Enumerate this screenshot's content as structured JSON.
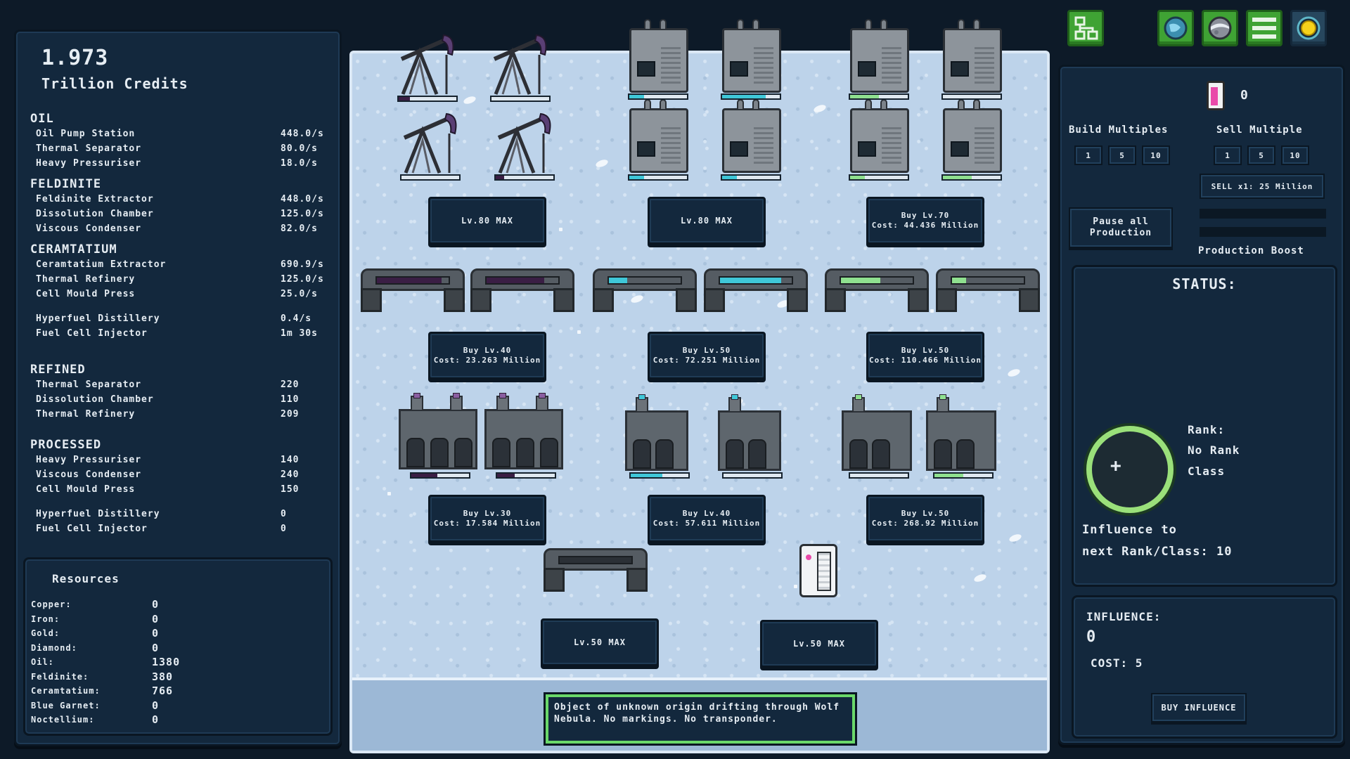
{
  "credits": {
    "amount": "1.973",
    "label": "Trillion Credits"
  },
  "stats": {
    "oil": {
      "title": "OIL",
      "rows": [
        {
          "name": "Oil Pump Station",
          "value": "448.0/s"
        },
        {
          "name": "Thermal Separator",
          "value": "80.0/s"
        },
        {
          "name": "Heavy Pressuriser",
          "value": "18.0/s"
        }
      ]
    },
    "feldinite": {
      "title": "FELDINITE",
      "rows": [
        {
          "name": "Feldinite Extractor",
          "value": "448.0/s"
        },
        {
          "name": "Dissolution Chamber",
          "value": "125.0/s"
        },
        {
          "name": "Viscous Condenser",
          "value": "82.0/s"
        }
      ]
    },
    "ceramtatium": {
      "title": "CERAMTATIUM",
      "rows": [
        {
          "name": "Ceramtatium Extractor",
          "value": "690.9/s"
        },
        {
          "name": "Thermal Refinery",
          "value": "125.0/s"
        },
        {
          "name": "Cell Mould Press",
          "value": "25.0/s"
        }
      ]
    },
    "fuel": {
      "rows": [
        {
          "name": "Hyperfuel Distillery",
          "value": "0.4/s"
        },
        {
          "name": "Fuel Cell Injector",
          "value": "1m 30s"
        }
      ]
    },
    "refined": {
      "title": "REFINED",
      "rows": [
        {
          "name": "Thermal Separator",
          "value": "220"
        },
        {
          "name": "Dissolution Chamber",
          "value": "110"
        },
        {
          "name": "Thermal Refinery",
          "value": "209"
        }
      ]
    },
    "processed": {
      "title": "PROCESSED",
      "rows": [
        {
          "name": "Heavy Pressuriser",
          "value": "140"
        },
        {
          "name": "Viscous Condenser",
          "value": "240"
        },
        {
          "name": "Cell Mould Press",
          "value": "150"
        }
      ]
    },
    "processed_fuel": {
      "rows": [
        {
          "name": "Hyperfuel Distillery",
          "value": "0"
        },
        {
          "name": "Fuel Cell Injector",
          "value": "0"
        }
      ]
    }
  },
  "resources": {
    "title": "Resources",
    "items": [
      {
        "name": "Copper:",
        "value": "0"
      },
      {
        "name": "Iron:",
        "value": "0"
      },
      {
        "name": "Gold:",
        "value": "0"
      },
      {
        "name": "Diamond:",
        "value": "0"
      },
      {
        "name": "Oil:",
        "value": "1380"
      },
      {
        "name": "Feldinite:",
        "value": "380"
      },
      {
        "name": "Ceramtatium:",
        "value": "766"
      },
      {
        "name": "Blue Garnet:",
        "value": "0"
      },
      {
        "name": "Noctellium:",
        "value": "0"
      }
    ]
  },
  "top_icons": [
    {
      "name": "network-icon"
    },
    {
      "name": "planet-blue-icon"
    },
    {
      "name": "planet-rock-icon"
    },
    {
      "name": "menu-icon"
    },
    {
      "name": "sun-icon"
    }
  ],
  "machines": {
    "row1": [
      {
        "label": "Lv.80 MAX",
        "line2": ""
      },
      {
        "label": "Lv.80 MAX",
        "line2": ""
      },
      {
        "label": "Buy Lv.70",
        "line2": "Cost: 44.436 Million"
      }
    ],
    "row2": [
      {
        "label": "Buy Lv.40",
        "line2": "Cost: 23.263 Million"
      },
      {
        "label": "Buy Lv.50",
        "line2": "Cost: 72.251 Million"
      },
      {
        "label": "Buy Lv.50",
        "line2": "Cost: 110.466 Million"
      }
    ],
    "row3": [
      {
        "label": "Buy Lv.30",
        "line2": "Cost: 17.584 Million"
      },
      {
        "label": "Buy Lv.40",
        "line2": "Cost: 57.611 Million"
      },
      {
        "label": "Buy Lv.50",
        "line2": "Cost: 268.92 Million"
      }
    ],
    "row4": [
      {
        "label": "Lv.50 MAX"
      },
      {
        "label": "Lv.50 MAX"
      }
    ],
    "progress": {
      "pumps": [
        0.2,
        0.0,
        0.0,
        0.15
      ],
      "tanks": [
        0.25,
        0.75,
        0.25,
        0.25,
        0.5,
        0.0,
        0.25,
        0.5
      ],
      "pipes": [
        0.9,
        0.8,
        0.25,
        0.85,
        0.55,
        0.2
      ],
      "factories": [
        0.45,
        0.3,
        0.55,
        0.0,
        0.0,
        0.5
      ]
    }
  },
  "colors": {
    "oil": "#3a1e44",
    "feldinite": "#3fc7d8",
    "ceramtatium": "#8fe08f",
    "accent_green": "#3fa334"
  },
  "right": {
    "fuel_count": "0",
    "build_multiples": {
      "label": "Build Multiples",
      "options": [
        "1",
        "5",
        "10"
      ]
    },
    "sell_multiple": {
      "label": "Sell Multiple",
      "options": [
        "1",
        "5",
        "10"
      ]
    },
    "sell_button": "SELL x1: 25 Million",
    "pause_line1": "Pause all",
    "pause_line2": "Production",
    "production_boost": "Production Boost",
    "status": {
      "title": "STATUS:",
      "rank_label": "Rank:",
      "rank_value": "No Rank",
      "class_label": "Class",
      "influence_line1": "Influence to",
      "influence_line2": "next Rank/Class: 10"
    },
    "influence": {
      "title": "INFLUENCE:",
      "value": "0",
      "cost": "COST: 5",
      "buy_button": "BUY INFLUENCE"
    }
  },
  "message": "Object of unknown origin drifting through Wolf Nebula. No markings. No transponder."
}
